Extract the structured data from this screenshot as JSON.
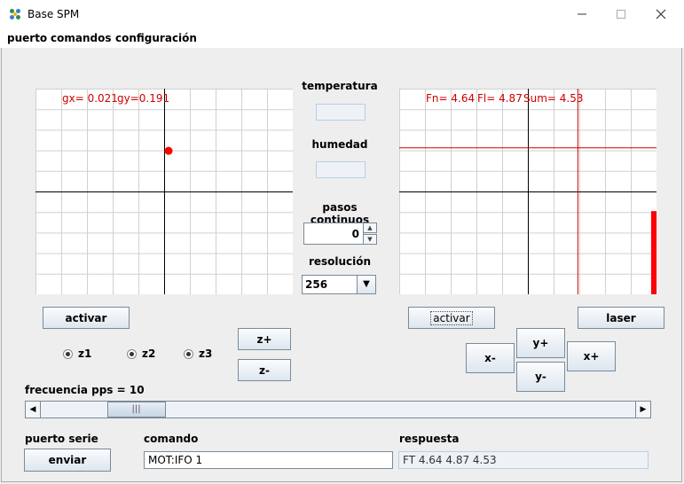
{
  "window": {
    "title": "Base SPM",
    "minimize_icon": "minimize-icon",
    "maximize_icon": "maximize-icon",
    "close_icon": "close-icon"
  },
  "menu": [
    "puerto",
    "comandos",
    "configuración"
  ],
  "left_plot": {
    "gx_label": "gx= 0.021",
    "gy_label": "gy=0.191",
    "gx": 0.021,
    "gy": 0.191,
    "marker_color": "#ff0000"
  },
  "right_plot": {
    "fn_label": "Fn= 4.64",
    "fl_label": "Fl= 4.87",
    "sum_label": "Sum= 4.53",
    "fn": 4.64,
    "fl": 4.87,
    "sum": 4.53,
    "line_color": "#cc0000"
  },
  "center": {
    "temperatura_label": "temperatura",
    "temperatura_value": "",
    "humedad_label": "humedad",
    "humedad_value": "",
    "pasos_label": "pasos continuos",
    "pasos_value": "0",
    "resolucion_label": "resolución",
    "resolucion_value": "256"
  },
  "left_controls": {
    "activar": "activar",
    "radios": [
      {
        "label": "z1",
        "checked": true
      },
      {
        "label": "z2",
        "checked": true
      },
      {
        "label": "z3",
        "checked": true
      }
    ],
    "z_plus": "z+",
    "z_minus": "z-"
  },
  "right_controls": {
    "activar": "activar",
    "laser": "laser",
    "x_minus": "x-",
    "x_plus": "x+",
    "y_plus": "y+",
    "y_minus": "y-"
  },
  "slider": {
    "label": "frecuencia pps = 10",
    "value": 10
  },
  "bottom": {
    "puerto_label": "puerto serie",
    "enviar": "enviar",
    "comando_label": "comando",
    "comando_value": "MOT:IFO 1",
    "respuesta_label": "respuesta",
    "respuesta_value": "FT 4.64 4.87 4.53"
  }
}
